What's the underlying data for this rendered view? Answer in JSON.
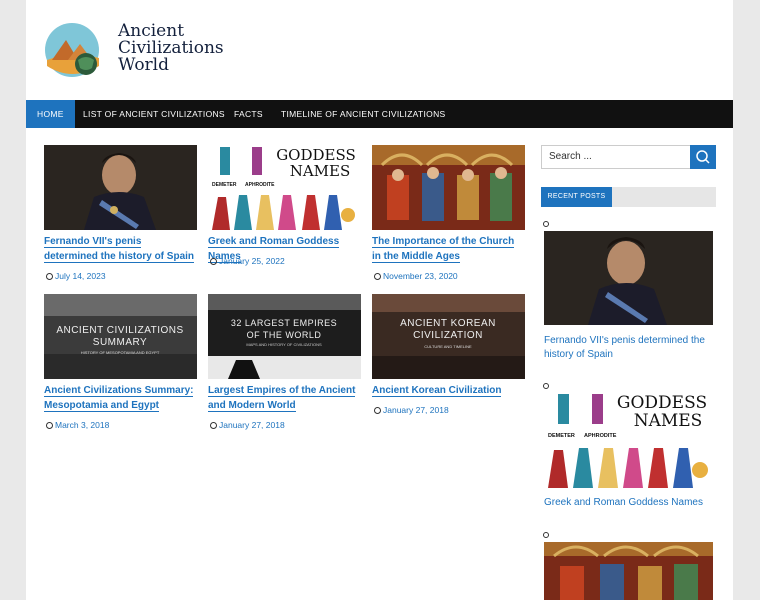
{
  "site": {
    "logo_line1": "Ancient",
    "logo_line2": "Civilizations",
    "logo_line3": "World"
  },
  "nav": {
    "items": [
      "Home",
      "List of Ancient Civilizations",
      "Facts",
      "Timeline of Ancient Civilizations"
    ]
  },
  "posts": [
    {
      "title": "Fernando VII's penis determined the history of Spain",
      "date": "July 14, 2023"
    },
    {
      "title": "Greek and Roman Goddess Names",
      "date": "January 25, 2022",
      "thumb_text1": "GODDESS",
      "thumb_text2": "NAMES",
      "thumb_cap1": "DEMETER",
      "thumb_cap2": "APHRODITE"
    },
    {
      "title": "The Importance of the Church in the Middle Ages",
      "date": "November 23, 2020"
    },
    {
      "title": "Ancient Civilizations Summary: Mesopotamia and Egypt",
      "date": "March 3, 2018",
      "thumb_text1": "ANCIENT CIVILIZATIONS",
      "thumb_text2": "SUMMARY",
      "thumb_sub": "HISTORY OF MESOPOTAMIA AND EGYPT"
    },
    {
      "title": "Largest Empires of the Ancient and Modern World",
      "date": "January 27, 2018",
      "thumb_text1": "32 LARGEST EMPIRES",
      "thumb_text2": "OF THE WORLD",
      "thumb_sub": "MAPS AND HISTORY OF CIVILIZATIONS"
    },
    {
      "title": "Ancient Korean Civilization",
      "date": "January 27, 2018",
      "thumb_text1": "ANCIENT KOREAN",
      "thumb_text2": "CIVILIZATION",
      "thumb_sub": "CULTURE AND TIMELINE"
    }
  ],
  "sidebar": {
    "search_placeholder": "Search ...",
    "recent_label": "Recent Posts",
    "recent": [
      {
        "title": "Fernando VII's penis determined the history of Spain"
      },
      {
        "title": "Greek and Roman Goddess Names",
        "thumb_text1": "GODDESS",
        "thumb_text2": "NAMES",
        "thumb_cap1": "DEMETER",
        "thumb_cap2": "APHRODITE"
      }
    ]
  },
  "colors": {
    "accent": "#1e73be",
    "nav_bg": "#111111"
  }
}
